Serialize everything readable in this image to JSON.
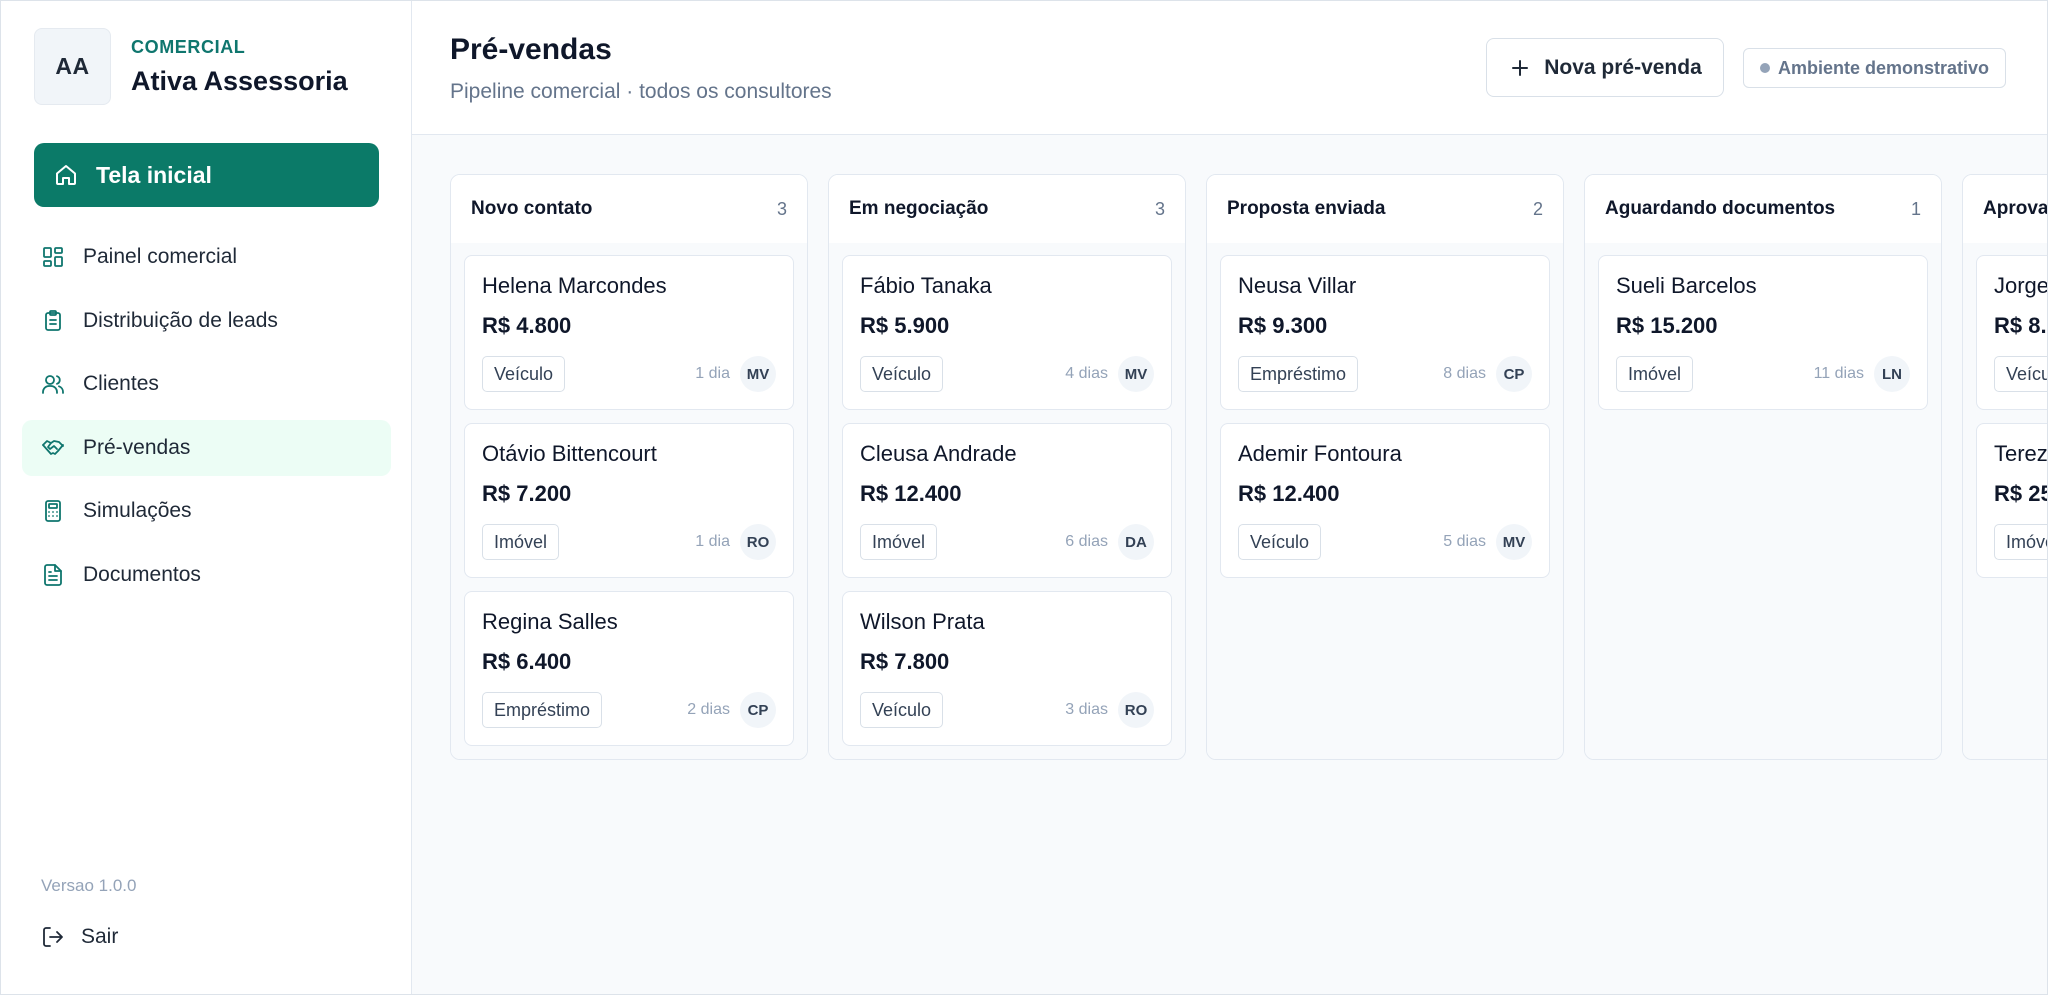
{
  "brand": {
    "initials": "AA",
    "eyebrow": "COMERCIAL",
    "name": "Ativa Assessoria"
  },
  "home": {
    "label": "Tela inicial"
  },
  "nav": [
    {
      "label": "Painel comercial",
      "icon": "dashboard-icon"
    },
    {
      "label": "Distribuição de leads",
      "icon": "clipboard-icon"
    },
    {
      "label": "Clientes",
      "icon": "users-icon"
    },
    {
      "label": "Pré-vendas",
      "icon": "handshake-icon",
      "active": true
    },
    {
      "label": "Simulações",
      "icon": "calculator-icon"
    },
    {
      "label": "Documentos",
      "icon": "document-icon"
    }
  ],
  "footer": {
    "version": "Versao 1.0.0",
    "logout": "Sair"
  },
  "header": {
    "title": "Pré-vendas",
    "subtitle": "Pipeline comercial · todos os consultores",
    "new_button": "Nova pré-venda",
    "environment": "Ambiente demonstrativo"
  },
  "colors": {
    "primary": "#0b7a68",
    "primary_text": "#0f766e",
    "active_bg": "#ecfdf5"
  },
  "columns": [
    {
      "title": "Novo contato",
      "count": "3",
      "cards": [
        {
          "name": "Helena Marcondes",
          "value": "R$ 4.800",
          "tag": "Veículo",
          "age": "1 dia",
          "owner": "MV"
        },
        {
          "name": "Otávio Bittencourt",
          "value": "R$ 7.200",
          "tag": "Imóvel",
          "age": "1 dia",
          "owner": "RO"
        },
        {
          "name": "Regina Salles",
          "value": "R$ 6.400",
          "tag": "Empréstimo",
          "age": "2 dias",
          "owner": "CP"
        }
      ]
    },
    {
      "title": "Em negociação",
      "count": "3",
      "cards": [
        {
          "name": "Fábio Tanaka",
          "value": "R$ 5.900",
          "tag": "Veículo",
          "age": "4 dias",
          "owner": "MV"
        },
        {
          "name": "Cleusa Andrade",
          "value": "R$ 12.400",
          "tag": "Imóvel",
          "age": "6 dias",
          "owner": "DA"
        },
        {
          "name": "Wilson Prata",
          "value": "R$ 7.800",
          "tag": "Veículo",
          "age": "3 dias",
          "owner": "RO"
        }
      ]
    },
    {
      "title": "Proposta enviada",
      "count": "2",
      "cards": [
        {
          "name": "Neusa Villar",
          "value": "R$ 9.300",
          "tag": "Empréstimo",
          "age": "8 dias",
          "owner": "CP"
        },
        {
          "name": "Ademir Fontoura",
          "value": "R$ 12.400",
          "tag": "Veículo",
          "age": "5 dias",
          "owner": "MV"
        }
      ]
    },
    {
      "title": "Aguardando documentos",
      "count": "1",
      "cards": [
        {
          "name": "Sueli Barcelos",
          "value": "R$ 15.200",
          "tag": "Imóvel",
          "age": "11 dias",
          "owner": "LN"
        }
      ]
    },
    {
      "title": "Aprova",
      "count": "",
      "cards": [
        {
          "name": "Jorge",
          "value": "R$ 8.",
          "tag": "Veícu",
          "age": "",
          "owner": ""
        },
        {
          "name": "Terez",
          "value": "R$ 25",
          "tag": "Imóve",
          "age": "",
          "owner": ""
        }
      ]
    }
  ]
}
